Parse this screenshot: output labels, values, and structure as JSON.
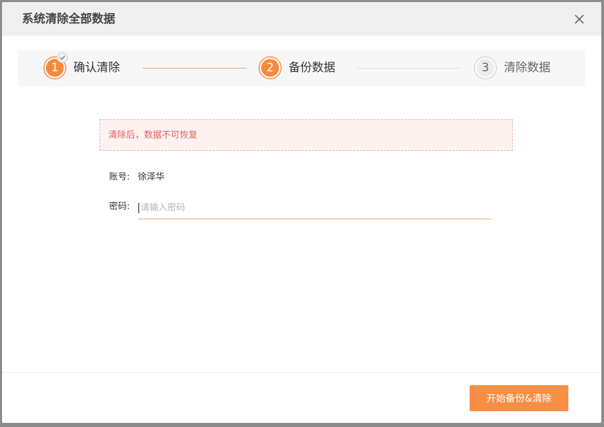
{
  "dialog": {
    "title": "系统清除全部数据"
  },
  "steps": [
    {
      "number": "1",
      "label": "确认清除",
      "state": "done"
    },
    {
      "number": "2",
      "label": "备份数据",
      "state": "active"
    },
    {
      "number": "3",
      "label": "清除数据",
      "state": "todo"
    }
  ],
  "alert": {
    "message": "清除后，数据不可恢复"
  },
  "account": {
    "label": "账号:",
    "value": "徐泽华"
  },
  "password": {
    "label": "密码:",
    "value": "",
    "placeholder": "请输入密码"
  },
  "footer": {
    "primary_label": "开始备份&清除"
  },
  "colors": {
    "accent": "#f68a3c",
    "alert_text": "#e0625a",
    "alert_bg": "#fef2f1"
  },
  "icons": {
    "close": "close-icon",
    "check": "check-icon"
  }
}
